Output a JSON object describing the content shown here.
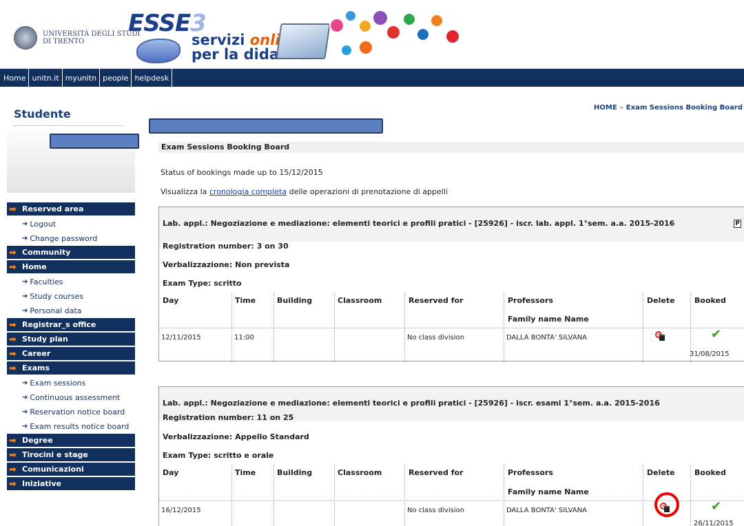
{
  "header": {
    "university": [
      "UNIVERSITÀ DEGLI STUDI",
      "DI TRENTO"
    ],
    "esse3": "ESSE",
    "esse3_num": "3",
    "servizi": "servizi",
    "online": "online",
    "didattica": "per la didattica"
  },
  "topnav": [
    "Home",
    "unitn.it",
    "myunitn",
    "people",
    "helpdesk"
  ],
  "sidebar": {
    "title": "Studente",
    "menu": [
      {
        "type": "main",
        "label": "Reserved area"
      },
      {
        "type": "sub",
        "label": "Logout"
      },
      {
        "type": "sub",
        "label": "Change password"
      },
      {
        "type": "main",
        "label": "Community"
      },
      {
        "type": "main",
        "label": "Home"
      },
      {
        "type": "sub",
        "label": "Faculties"
      },
      {
        "type": "sub",
        "label": "Study courses"
      },
      {
        "type": "sub",
        "label": "Personal data"
      },
      {
        "type": "main",
        "label": "Registrar_s office"
      },
      {
        "type": "main",
        "label": "Study plan"
      },
      {
        "type": "main",
        "label": "Career"
      },
      {
        "type": "main",
        "label": "Exams"
      },
      {
        "type": "sub",
        "label": "Exam sessions"
      },
      {
        "type": "sub",
        "label": "Continuous assessment"
      },
      {
        "type": "sub",
        "label": "Reservation notice board"
      },
      {
        "type": "sub",
        "label": "Exam results notice board"
      },
      {
        "type": "main",
        "label": "Degree"
      },
      {
        "type": "main",
        "label": "Tirocini e stage"
      },
      {
        "type": "main",
        "label": "Comunicazioni"
      },
      {
        "type": "main",
        "label": "Iniziative"
      }
    ]
  },
  "breadcrumb": {
    "home": "HOME",
    "sep": "»",
    "current": "Exam Sessions Booking Board"
  },
  "main": {
    "board_title": "Exam Sessions Booking Board",
    "status": "Status of bookings made up to 15/12/2015",
    "visualizza_pre": "Visualizza la ",
    "visualizza_link": "cronologia completa",
    "visualizza_post": " delle operazioni di prenotazione di appelli",
    "columns": {
      "day": "Day",
      "time": "Time",
      "building": "Building",
      "classroom": "Classroom",
      "reserved": "Reserved for",
      "professors": "Professors",
      "family": "Family name Name",
      "delete": "Delete",
      "booked": "Booked"
    },
    "bookings": [
      {
        "course": "Lab. appl.: Negoziazione e mediazione: elementi teorici e profili pratici - [25926] - iscr. lab. appl. 1°sem. a.a. 2015-2016",
        "p_label": "P",
        "registration": "Registration number: 3 on 30",
        "verbal": "Verbalizzazione: Non prevista",
        "exam_type": "Exam Type: scritto",
        "day": "12/11/2015",
        "time": "11:00",
        "reserved": "No class division",
        "professor": "DALLA BONTA' SILVANA",
        "booked_date": "31/08/2015"
      },
      {
        "course": "Lab. appl.: Negoziazione e mediazione: elementi teorici e profili pratici - [25926] - iscr. esami 1°sem. a.a. 2015-2016",
        "registration": "Registration number: 11 on 25",
        "verbal": "Verbalizzazione: Appello Standard",
        "exam_type": "Exam Type: scritto e orale",
        "day": "16/12/2015",
        "time": "",
        "reserved": "No class division",
        "professor": "DALLA BONTA' SILVANA",
        "booked_date": "26/11/2015"
      }
    ]
  },
  "colors": {
    "navy": "#12305e",
    "accent": "#f07f1e",
    "check": "#3c9a1e",
    "highlight": "#e00000"
  }
}
